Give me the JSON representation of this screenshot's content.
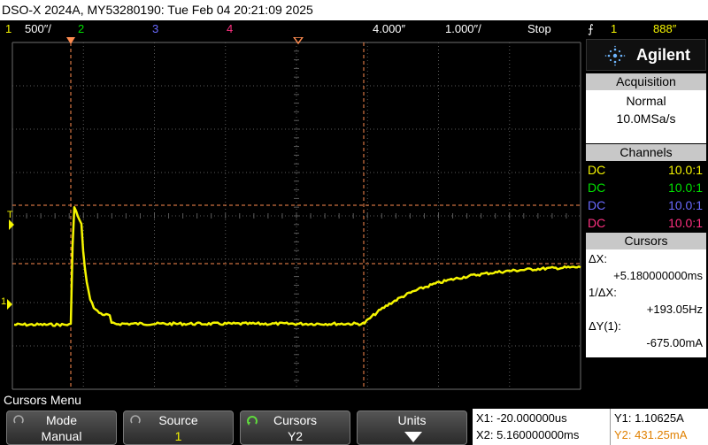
{
  "title_bar": {
    "text": "DSO-X 2024A, MY53280190: Tue Feb 04 20:21:09 2025"
  },
  "status_bar": {
    "ch1_num": "1",
    "ch1_scale": "500″/",
    "ch2_num": "2",
    "ch3_num": "3",
    "ch4_num": "4",
    "delay": "4.000″",
    "timebase": "1.000″/",
    "run_state": "Stop",
    "trigger_source": "1",
    "trigger_level": "888″"
  },
  "brand": {
    "name": "Agilent"
  },
  "acquisition": {
    "header": "Acquisition",
    "mode": "Normal",
    "rate": "10.0MSa/s"
  },
  "channels": {
    "header": "Channels",
    "rows": [
      {
        "coupling": "DC",
        "probe": "10.0:1",
        "color": "#f5f500"
      },
      {
        "coupling": "DC",
        "probe": "10.0:1",
        "color": "#00e000"
      },
      {
        "coupling": "DC",
        "probe": "10.0:1",
        "color": "#6a6aff"
      },
      {
        "coupling": "DC",
        "probe": "10.0:1",
        "color": "#ff3080"
      }
    ]
  },
  "cursors_panel": {
    "header": "Cursors",
    "dx_label": "ΔX:",
    "dx_value": "+5.180000000ms",
    "inv_dx_label": "1/ΔX:",
    "inv_dx_value": "+193.05Hz",
    "dy_label": "ΔY(1):",
    "dy_value": "-675.00mA"
  },
  "screen_markers": {
    "trigger_marker": "T",
    "ch1_ground_marker": "1"
  },
  "menu": {
    "title": "Cursors Menu",
    "softkeys": [
      {
        "top": "Mode",
        "bottom": "Manual"
      },
      {
        "top": "Source",
        "bottom": "1"
      },
      {
        "top": "Cursors",
        "bottom": "Y2"
      },
      {
        "top": "Units",
        "bottom": ""
      }
    ]
  },
  "cursor_readout": {
    "x1": "X1: -20.000000us",
    "x2": "X2: 5.160000000ms",
    "y1": "Y1: 1.10625A",
    "y2": "Y2: 431.25mA"
  },
  "colors": {
    "ch1": "#f5f500",
    "ch2": "#00e000",
    "ch3": "#6a6aff",
    "ch4": "#ff3080",
    "cursor": "#ff8c50",
    "grid": "#5a5a5a"
  }
}
